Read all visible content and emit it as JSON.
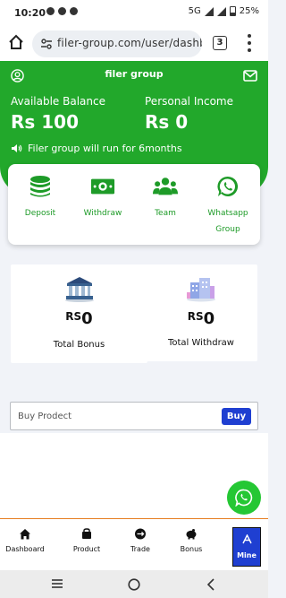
{
  "status_bar": {
    "time": "10:20",
    "battery": "25%",
    "network": "5G"
  },
  "browser": {
    "url": "filer-group.com/user/dashboa",
    "tab_count": "3"
  },
  "header": {
    "title": "filer group",
    "balance_label": "Available Balance",
    "balance_value": "Rs 100",
    "income_label": "Personal Income",
    "income_value": "Rs 0",
    "notice": "Filer group will run for 6months"
  },
  "actions": [
    {
      "label": "Deposit",
      "icon": "coins-icon"
    },
    {
      "label": "Withdraw",
      "icon": "cash-icon"
    },
    {
      "label": "Team",
      "icon": "team-icon"
    },
    {
      "label": "Whatsapp Group",
      "icon": "whatsapp-icon"
    }
  ],
  "stats": [
    {
      "currency": "RS",
      "value": "0",
      "label": "Total Bonus",
      "icon": "bank-icon"
    },
    {
      "currency": "RS",
      "value": "0",
      "label": "Total Withdraw",
      "icon": "building-icon"
    }
  ],
  "buy": {
    "placeholder": "Buy Prodect",
    "button": "Buy"
  },
  "bottom_nav": [
    {
      "label": "Dashboard",
      "icon": "home-icon"
    },
    {
      "label": "Product",
      "icon": "product-icon"
    },
    {
      "label": "Trade",
      "icon": "trade-icon"
    },
    {
      "label": "Bonus",
      "icon": "piggy-bank-icon"
    },
    {
      "label": "Mine",
      "icon": "mine-icon",
      "active": true
    }
  ],
  "colors": {
    "primary_green": "#22a82b",
    "action_green": "#1e9b28",
    "blue": "#1f3fd1",
    "nav_border": "#e67e22"
  }
}
